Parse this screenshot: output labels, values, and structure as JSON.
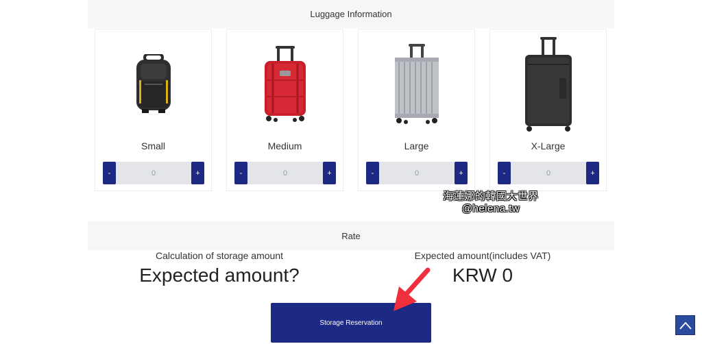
{
  "luggage_section": {
    "title": "Luggage Information"
  },
  "luggage": [
    {
      "name": "Small",
      "quantity": "0",
      "minus": "-",
      "plus": "+",
      "icon": "backpack-icon"
    },
    {
      "name": "Medium",
      "quantity": "0",
      "minus": "-",
      "plus": "+",
      "icon": "red-suitcase-icon"
    },
    {
      "name": "Large",
      "quantity": "0",
      "minus": "-",
      "plus": "+",
      "icon": "silver-suitcase-icon"
    },
    {
      "name": "X-Large",
      "quantity": "0",
      "minus": "-",
      "plus": "+",
      "icon": "black-suitcase-icon"
    }
  ],
  "watermark": {
    "line1": "海蓮娜的韓國大世界",
    "line2": "@helena.tw"
  },
  "rate_section": {
    "title": "Rate"
  },
  "calculation": {
    "left_label": "Calculation of storage amount",
    "left_value": "Expected amount?",
    "right_label": "Expected amount(includes VAT)",
    "right_value": "KRW 0"
  },
  "reserve_button": {
    "label": "Storage Reservation"
  },
  "colors": {
    "primary": "#1c2a86",
    "section_bg": "#f6f6f7",
    "input_bg": "#e3e5e8",
    "arrow": "#ef2f3c"
  }
}
